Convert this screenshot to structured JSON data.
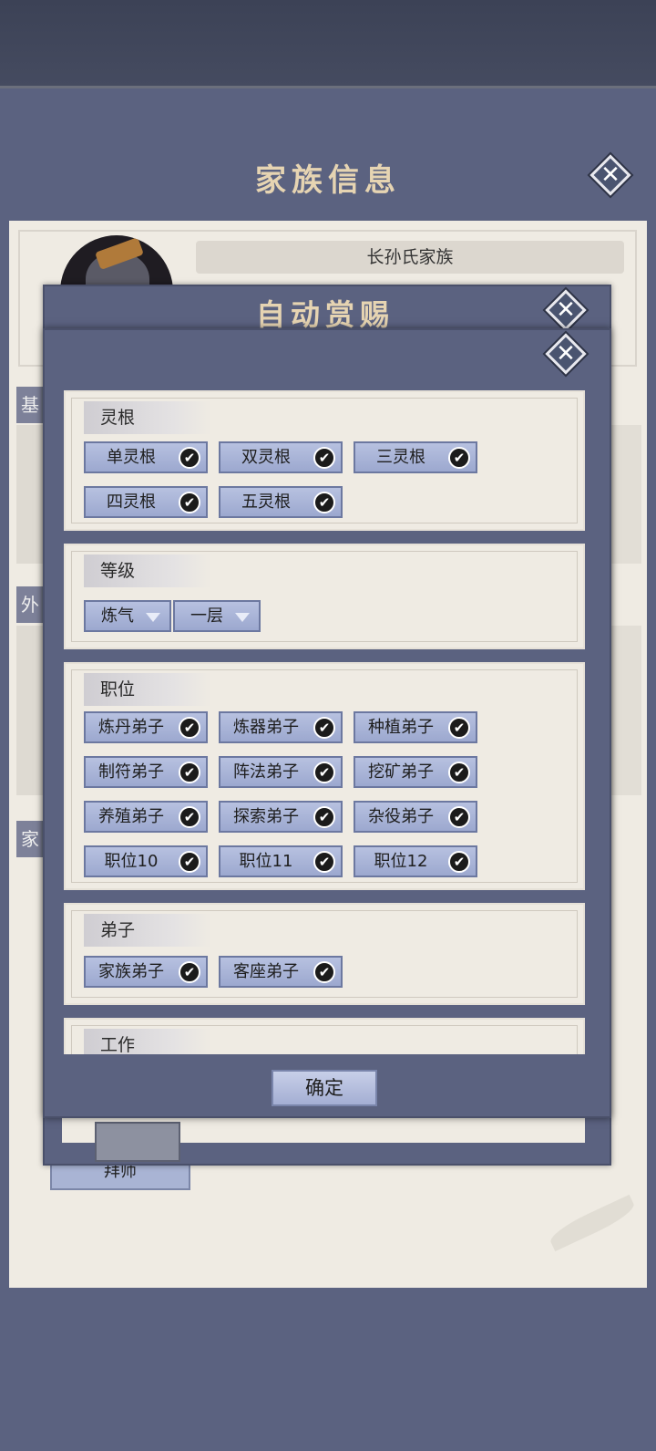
{
  "background_window": {
    "title": "家族信息",
    "family_name": "长孙氏家族",
    "side_tabs": [
      "基",
      "外",
      "家"
    ],
    "bottom_button": "拜师"
  },
  "modal_outer": {
    "title": "自动赏赐"
  },
  "modal": {
    "sections": {
      "spirit_root": {
        "title": "灵根",
        "options": [
          {
            "label": "单灵根",
            "checked": true
          },
          {
            "label": "双灵根",
            "checked": true
          },
          {
            "label": "三灵根",
            "checked": true
          },
          {
            "label": "四灵根",
            "checked": true
          },
          {
            "label": "五灵根",
            "checked": true
          }
        ]
      },
      "level": {
        "title": "等级",
        "realm_value": "炼气",
        "layer_value": "一层"
      },
      "position": {
        "title": "职位",
        "options": [
          {
            "label": "炼丹弟子",
            "checked": true
          },
          {
            "label": "炼器弟子",
            "checked": true
          },
          {
            "label": "种植弟子",
            "checked": true
          },
          {
            "label": "制符弟子",
            "checked": true
          },
          {
            "label": "阵法弟子",
            "checked": true
          },
          {
            "label": "挖矿弟子",
            "checked": true
          },
          {
            "label": "养殖弟子",
            "checked": true
          },
          {
            "label": "探索弟子",
            "checked": true
          },
          {
            "label": "杂役弟子",
            "checked": true
          },
          {
            "label": "职位10",
            "checked": true
          },
          {
            "label": "职位11",
            "checked": true
          },
          {
            "label": "职位12",
            "checked": true
          }
        ]
      },
      "disciple": {
        "title": "弟子",
        "options": [
          {
            "label": "家族弟子",
            "checked": true
          },
          {
            "label": "客座弟子",
            "checked": true
          }
        ]
      },
      "work": {
        "title": "工作"
      }
    },
    "confirm_label": "确定",
    "tick_glyph": "✔"
  },
  "colors": {
    "panel": "#5b6280",
    "paper": "#efebe3",
    "checkbox": "#a9b4d8",
    "title_gold": "#e6d4b2"
  }
}
